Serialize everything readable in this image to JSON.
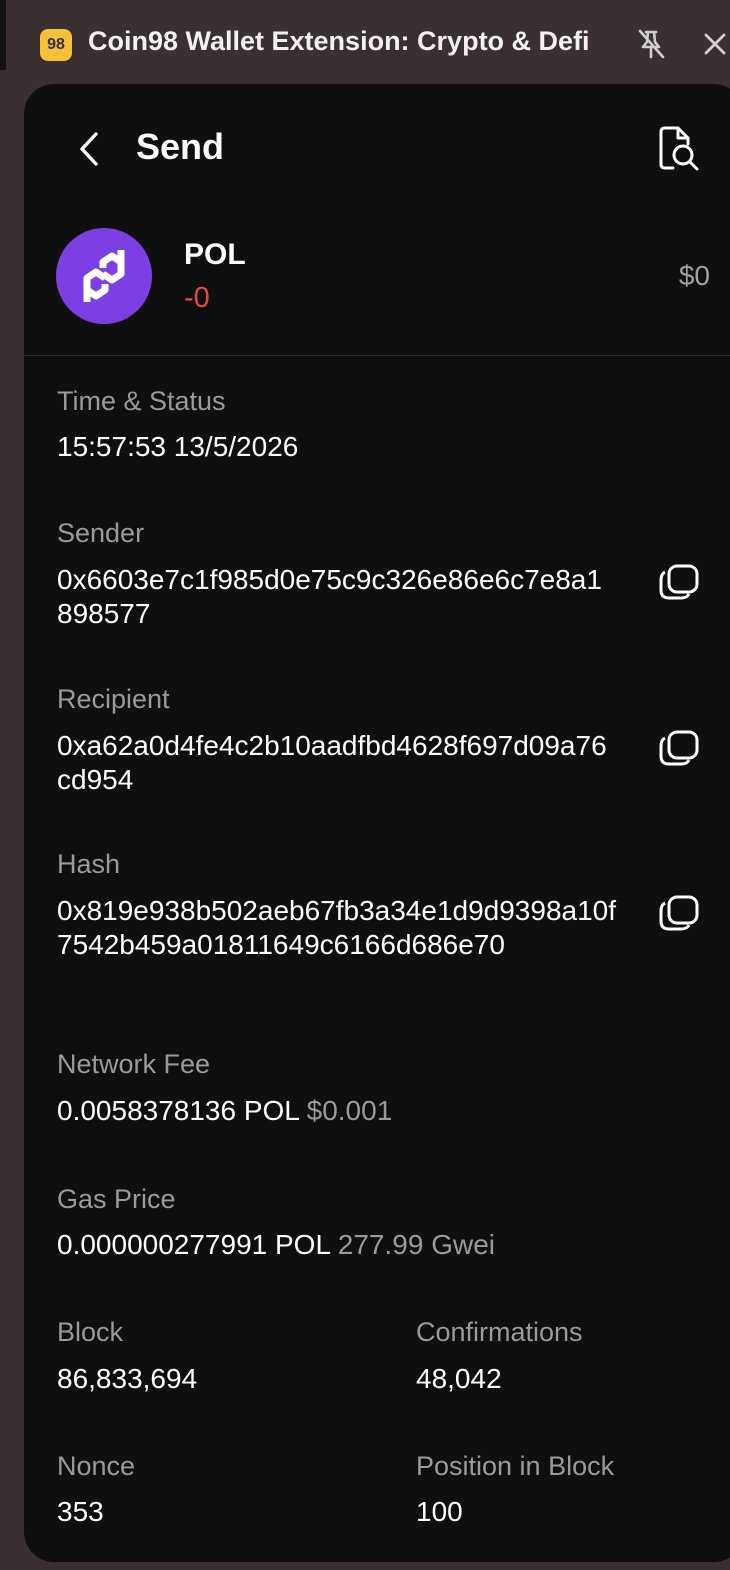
{
  "browser": {
    "extension_title": "Coin98 Wallet Extension: Crypto & Defi",
    "extension_icon_text": "98"
  },
  "header": {
    "title": "Send"
  },
  "token": {
    "symbol": "POL",
    "amount": "-0",
    "usd_value": "$0",
    "logo_color": "#7b3fe4"
  },
  "details": {
    "time_status_label": "Time & Status",
    "time_status_value": "15:57:53 13/5/2026",
    "sender_label": "Sender",
    "sender_value": "0x6603e7c1f985d0e75c9c326e86e6c7e8a1898577",
    "recipient_label": "Recipient",
    "recipient_value": "0xa62a0d4fe4c2b10aadfbd4628f697d09a76cd954",
    "hash_label": "Hash",
    "hash_value": "0x819e938b502aeb67fb3a34e1d9d9398a10f7542b459a01811649c6166d686e70",
    "network_fee_label": "Network Fee",
    "network_fee_value": "0.0058378136 POL",
    "network_fee_usd": "$0.001",
    "gas_price_label": "Gas Price",
    "gas_price_value": "0.000000277991 POL",
    "gas_price_gwei": "277.99 Gwei",
    "block_label": "Block",
    "block_value": "86,833,694",
    "confirmations_label": "Confirmations",
    "confirmations_value": "48,042",
    "nonce_label": "Nonce",
    "nonce_value": "353",
    "position_label": "Position in Block",
    "position_value": "100"
  },
  "colors": {
    "negative": "#e5483f",
    "panel_bg": "#0f0f10",
    "muted_text": "#9a9a9a"
  }
}
